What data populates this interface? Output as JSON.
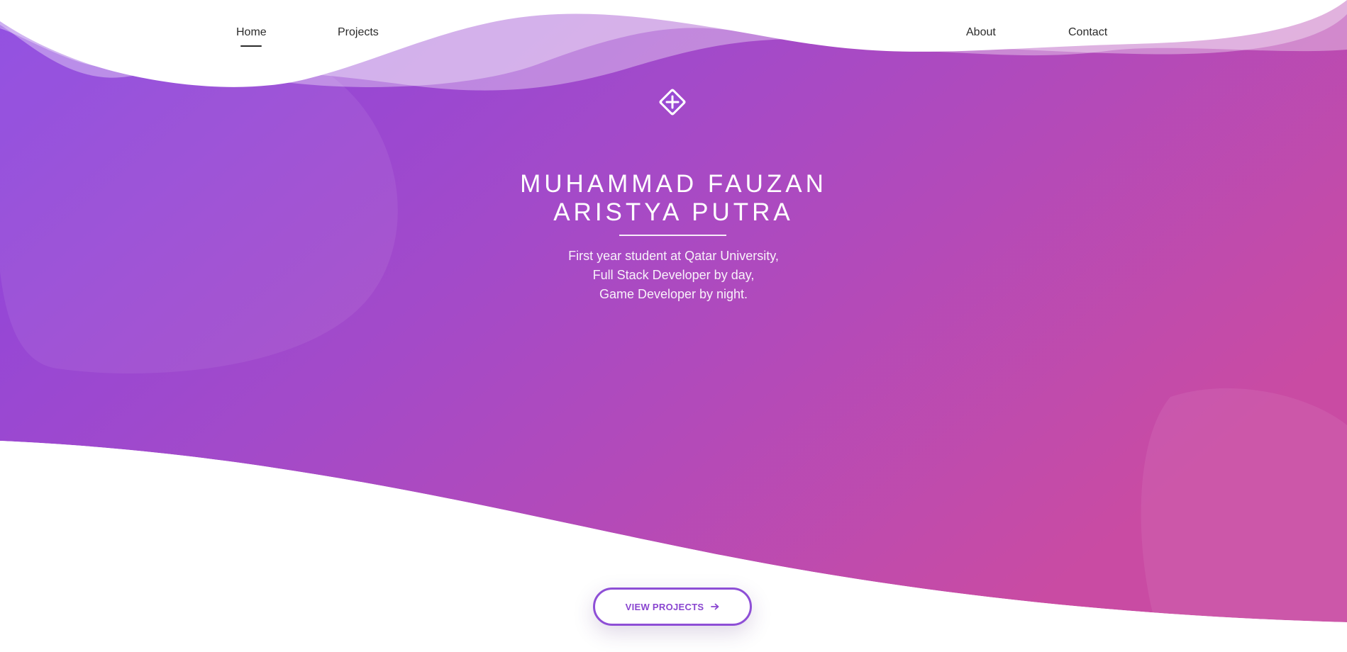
{
  "nav": {
    "left": [
      {
        "label": "Home",
        "active": true
      },
      {
        "label": "Projects",
        "active": false
      }
    ],
    "right": [
      {
        "label": "About",
        "active": false
      },
      {
        "label": "Contact",
        "active": false
      }
    ]
  },
  "hero": {
    "logo_icon": "diamond-plus-icon",
    "title_lines": [
      "MUHAMMAD FAUZAN",
      "ARISTYA PUTRA"
    ],
    "description_lines": [
      "First year student at Qatar University,",
      "Full Stack Developer by day,",
      "Game Developer by night."
    ]
  },
  "cta": {
    "label": "VIEW PROJECTS",
    "icon": "arrow-right-icon"
  },
  "colors": {
    "gradient_start": "#8a44e0",
    "gradient_end": "#c64aa6",
    "accent": "#8e4fd6",
    "nav_text": "#2b2b2b"
  }
}
